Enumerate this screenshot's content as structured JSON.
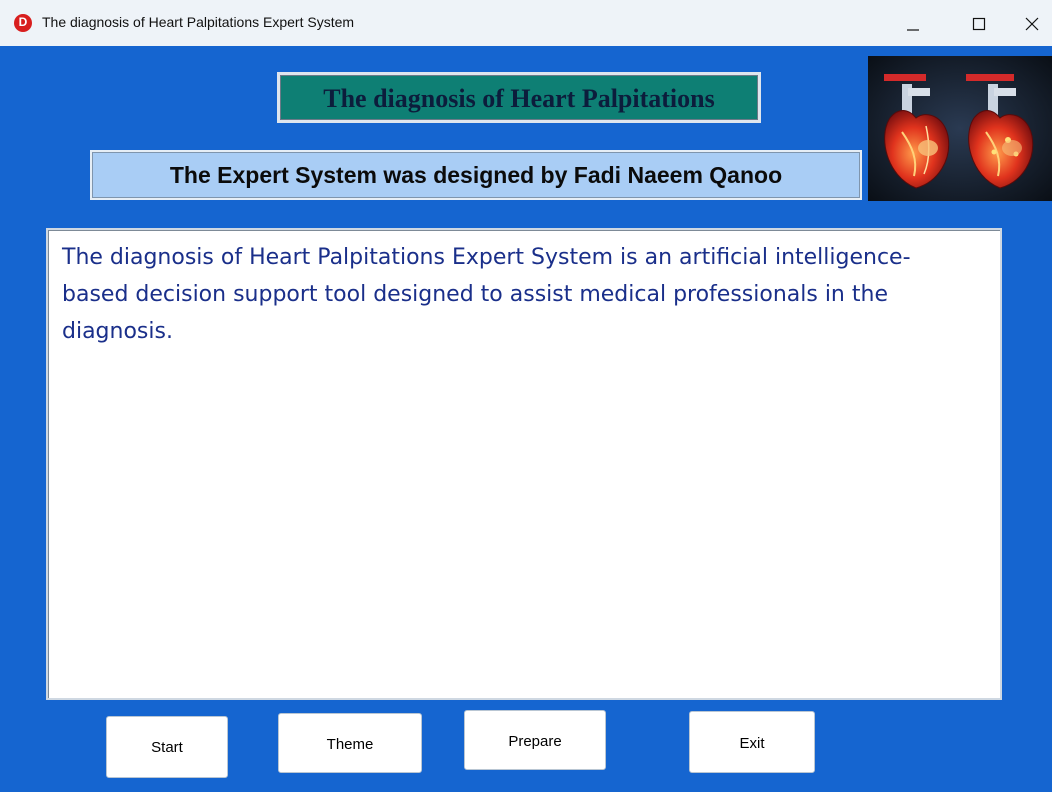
{
  "window": {
    "app_icon_letter": "D",
    "title": "The diagnosis of Heart Palpitations Expert System",
    "controls": [
      "minimize-icon",
      "maximize-icon",
      "close-icon"
    ]
  },
  "header": {
    "title": "The diagnosis of Heart Palpitations",
    "subtitle": "The Expert System was designed by Fadi Naeem Qanoo"
  },
  "image": {
    "icons": [
      "heart-icon",
      "heart-icon"
    ]
  },
  "content": {
    "text": "The diagnosis of Heart Palpitations Expert System is an artificial intelligence-based decision support tool designed to assist medical professionals in the diagnosis."
  },
  "buttons": {
    "start": "Start",
    "theme": "Theme",
    "prepare": "Prepare",
    "exit": "Exit"
  },
  "colors": {
    "background": "#1565d0",
    "title_bg": "#0e7f74",
    "subtitle_bg": "#a9cdf5",
    "text": "#1a2f8a"
  }
}
